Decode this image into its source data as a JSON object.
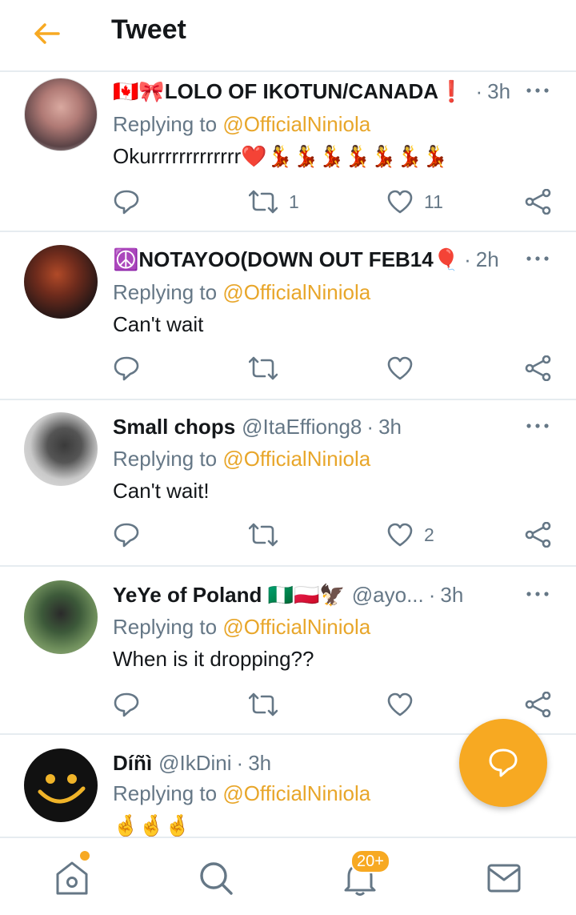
{
  "header": {
    "title": "Tweet",
    "back_icon": "arrow-left-icon"
  },
  "colors": {
    "accent": "#f7a922",
    "mention": "#e8a62a",
    "secondary_text": "#657786",
    "divider": "#e6ecf0"
  },
  "reply_prefix": "Replying to",
  "tweets": [
    {
      "name": "🇨🇦🎀LOLO OF IKOTUN/CANADA❗",
      "handle": "",
      "time": "3h",
      "reply_to": "@OfficialNiniola",
      "text": "Okurrrrrrrrrrrrr❤️💃💃💃💃💃💃💃",
      "retweets": "1",
      "likes": "11"
    },
    {
      "name": "☮️NOTAYOO(DOWN OUT FEB14🎈",
      "handle": "",
      "time": "2h",
      "reply_to": "@OfficialNiniola",
      "text": "Can't wait",
      "retweets": "",
      "likes": ""
    },
    {
      "name": "Small chops",
      "handle": "@ItaEffiong8",
      "time": "3h",
      "reply_to": "@OfficialNiniola",
      "text": "Can't wait!",
      "retweets": "",
      "likes": "2"
    },
    {
      "name": "YeYe of Poland 🇳🇬🇵🇱🦅",
      "handle": "@ayo...",
      "time": "3h",
      "reply_to": "@OfficialNiniola",
      "text": "When is it dropping??",
      "retweets": "",
      "likes": ""
    },
    {
      "name": "Díñì",
      "handle": "@IkDini",
      "time": "3h",
      "reply_to": "@OfficialNiniola",
      "text": "🤞🤞🤞",
      "retweets": "",
      "likes": ""
    }
  ],
  "bottom_nav": {
    "items": [
      "home-icon",
      "search-icon",
      "notifications-icon",
      "messages-icon"
    ],
    "notifications_badge": "20+"
  }
}
